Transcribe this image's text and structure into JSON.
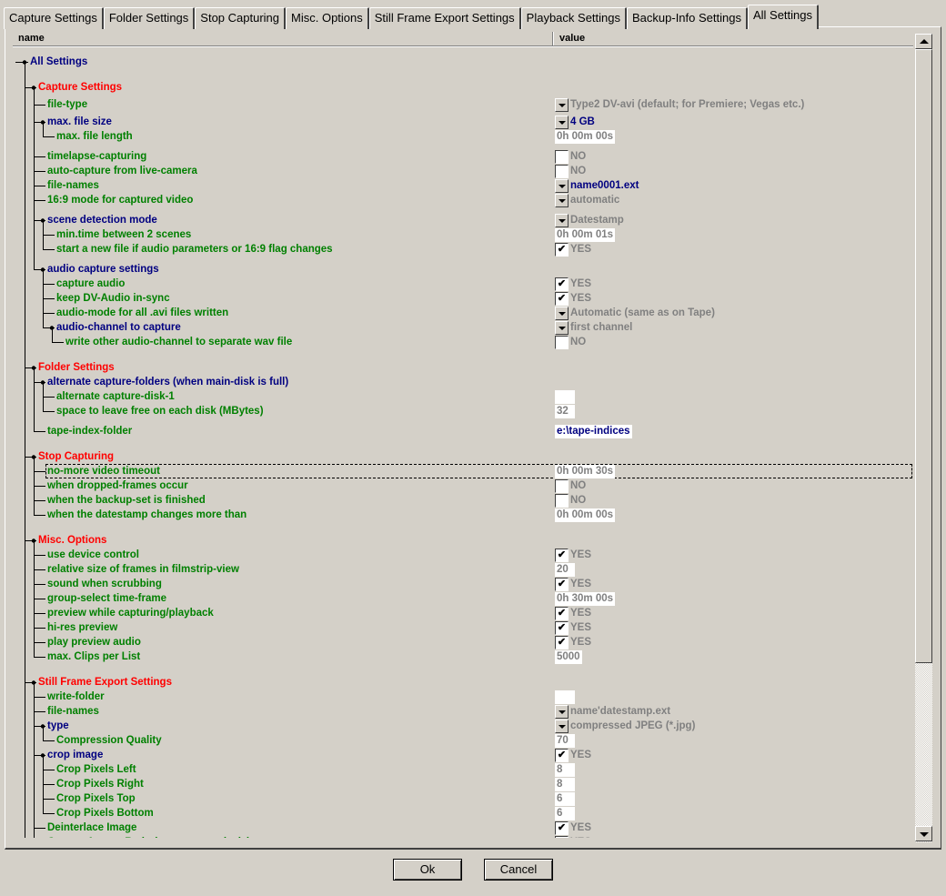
{
  "tabs": [
    "Capture Settings",
    "Folder Settings",
    "Stop Capturing",
    "Misc. Options",
    "Still Frame Export Settings",
    "Playback Settings",
    "Backup-Info Settings",
    "All Settings"
  ],
  "active_tab": 7,
  "columns": {
    "name": "name",
    "value": "value"
  },
  "colors": {
    "section": "#ff0000",
    "parent": "#000080",
    "leaf": "#008000",
    "disabled_value": "#808080",
    "enabled_value": "#000080"
  },
  "rows": [
    {
      "level": 0,
      "label": "All Settings",
      "kind": "parent"
    },
    {
      "level": 1,
      "label": "Capture Settings",
      "kind": "section"
    },
    {
      "level": 2,
      "label": "file-type",
      "kind": "leaf",
      "type": "dropdown",
      "value": "Type2 DV-avi (default; for Premiere; Vegas etc.)"
    },
    {
      "level": 2,
      "label": "max. file size",
      "kind": "parent",
      "type": "dropdown",
      "value": "4 GB",
      "enabled": true
    },
    {
      "level": 3,
      "label": "max. file length",
      "kind": "leaf",
      "type": "box",
      "value": "0h 00m 00s"
    },
    {
      "level": 2,
      "label": "timelapse-capturing",
      "kind": "leaf",
      "type": "check",
      "value": "NO"
    },
    {
      "level": 2,
      "label": "auto-capture from live-camera",
      "kind": "leaf",
      "type": "check",
      "value": "NO"
    },
    {
      "level": 2,
      "label": "file-names",
      "kind": "leaf",
      "type": "dropdown",
      "value": "name0001.ext",
      "enabled": true
    },
    {
      "level": 2,
      "label": "16:9 mode for captured video",
      "kind": "leaf",
      "type": "dropdown",
      "value": "automatic"
    },
    {
      "level": 2,
      "label": "scene detection mode",
      "kind": "parent",
      "type": "dropdown",
      "value": "Datestamp"
    },
    {
      "level": 3,
      "label": "min.time between 2 scenes",
      "kind": "leaf",
      "type": "box",
      "value": "0h 00m 01s"
    },
    {
      "level": 3,
      "label": "start a new file if audio parameters or 16:9 flag changes",
      "kind": "leaf",
      "type": "check",
      "value": "YES"
    },
    {
      "level": 2,
      "label": "audio capture settings",
      "kind": "parent"
    },
    {
      "level": 3,
      "label": "capture audio",
      "kind": "leaf",
      "type": "check",
      "value": "YES"
    },
    {
      "level": 3,
      "label": "keep DV-Audio in-sync",
      "kind": "leaf",
      "type": "check",
      "value": "YES"
    },
    {
      "level": 3,
      "label": "audio-mode for all .avi files written",
      "kind": "leaf",
      "type": "dropdown",
      "value": "Automatic (same as on Tape)"
    },
    {
      "level": 3,
      "label": "audio-channel to capture",
      "kind": "parent",
      "type": "dropdown",
      "value": "first channel"
    },
    {
      "level": 4,
      "label": "write other audio-channel to separate wav file",
      "kind": "leaf",
      "type": "check",
      "value": "NO"
    },
    {
      "level": 1,
      "label": "Folder Settings",
      "kind": "section"
    },
    {
      "level": 2,
      "label": "alternate capture-folders (when main-disk is full)",
      "kind": "parent"
    },
    {
      "level": 3,
      "label": "alternate capture-disk-1",
      "kind": "leaf",
      "type": "box",
      "value": ""
    },
    {
      "level": 3,
      "label": "space to leave free on each disk (MBytes)",
      "kind": "leaf",
      "type": "box",
      "value": "32"
    },
    {
      "level": 2,
      "label": "tape-index-folder",
      "kind": "leaf",
      "type": "box",
      "value": "e:\\tape-indices",
      "enabled": true
    },
    {
      "level": 1,
      "label": "Stop Capturing",
      "kind": "section"
    },
    {
      "level": 2,
      "label": "no-more video timeout",
      "kind": "leaf",
      "type": "box",
      "value": "0h 00m 30s",
      "focused": true
    },
    {
      "level": 2,
      "label": "when dropped-frames occur",
      "kind": "leaf",
      "type": "check",
      "value": "NO"
    },
    {
      "level": 2,
      "label": "when the backup-set is finished",
      "kind": "leaf",
      "type": "check",
      "value": "NO"
    },
    {
      "level": 2,
      "label": "when the datestamp changes more than",
      "kind": "leaf",
      "type": "box",
      "value": "0h 00m 00s"
    },
    {
      "level": 1,
      "label": "Misc. Options",
      "kind": "section"
    },
    {
      "level": 2,
      "label": "use device control",
      "kind": "leaf",
      "type": "check",
      "value": "YES"
    },
    {
      "level": 2,
      "label": "relative size of frames in filmstrip-view",
      "kind": "leaf",
      "type": "box",
      "value": "20"
    },
    {
      "level": 2,
      "label": "sound when scrubbing",
      "kind": "leaf",
      "type": "check",
      "value": "YES"
    },
    {
      "level": 2,
      "label": "group-select time-frame",
      "kind": "leaf",
      "type": "box",
      "value": "0h 30m 00s"
    },
    {
      "level": 2,
      "label": "preview while capturing/playback",
      "kind": "leaf",
      "type": "check",
      "value": "YES"
    },
    {
      "level": 2,
      "label": "hi-res preview",
      "kind": "leaf",
      "type": "check",
      "value": "YES"
    },
    {
      "level": 2,
      "label": "play preview audio",
      "kind": "leaf",
      "type": "check",
      "value": "YES"
    },
    {
      "level": 2,
      "label": "max. Clips per List",
      "kind": "leaf",
      "type": "box",
      "value": "5000"
    },
    {
      "level": 1,
      "label": "Still Frame Export Settings",
      "kind": "section"
    },
    {
      "level": 2,
      "label": "write-folder",
      "kind": "leaf",
      "type": "box",
      "value": ""
    },
    {
      "level": 2,
      "label": "file-names",
      "kind": "leaf",
      "type": "dropdown",
      "value": "name'datestamp.ext"
    },
    {
      "level": 2,
      "label": "type",
      "kind": "parent",
      "type": "dropdown",
      "value": "compressed JPEG (*.jpg)"
    },
    {
      "level": 3,
      "label": "Compression Quality",
      "kind": "leaf",
      "type": "box",
      "value": "70"
    },
    {
      "level": 2,
      "label": "crop image",
      "kind": "parent",
      "type": "check",
      "value": "YES"
    },
    {
      "level": 3,
      "label": "Crop Pixels Left",
      "kind": "leaf",
      "type": "box",
      "value": "8"
    },
    {
      "level": 3,
      "label": "Crop Pixels Right",
      "kind": "leaf",
      "type": "box",
      "value": "8"
    },
    {
      "level": 3,
      "label": "Crop Pixels Top",
      "kind": "leaf",
      "type": "box",
      "value": "6"
    },
    {
      "level": 3,
      "label": "Crop Pixels Bottom",
      "kind": "leaf",
      "type": "box",
      "value": "6"
    },
    {
      "level": 2,
      "label": "Deinterlace Image",
      "kind": "leaf",
      "type": "check",
      "value": "YES"
    },
    {
      "level": 2,
      "label": "Correct Aspect Ratio (non-square pixels)",
      "kind": "leaf",
      "type": "check",
      "value": "YES"
    }
  ],
  "buttons": {
    "ok": "Ok",
    "cancel": "Cancel"
  }
}
